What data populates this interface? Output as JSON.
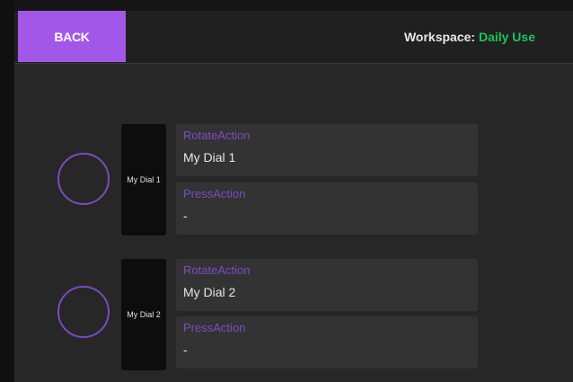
{
  "header": {
    "back_label": "BACK",
    "workspace_label": "Workspace:",
    "workspace_name": "Daily Use"
  },
  "dials": [
    {
      "label": "My Dial 1",
      "rotate_title": "RotateAction",
      "rotate_value": "My Dial 1",
      "press_title": "PressAction",
      "press_value": "-"
    },
    {
      "label": "My Dial 2",
      "rotate_title": "RotateAction",
      "rotate_value": "My Dial 2",
      "press_title": "PressAction",
      "press_value": "-"
    }
  ],
  "colors": {
    "accent": "#a357e8",
    "workspace_name": "#1ec25a",
    "action_title": "#7d4bc4"
  }
}
